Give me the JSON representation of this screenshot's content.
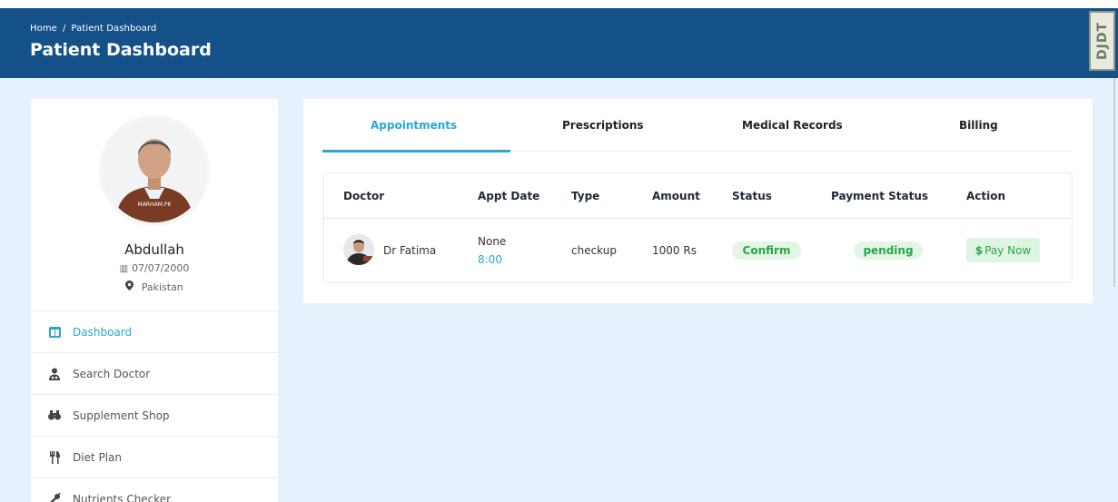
{
  "header": {
    "breadcrumb": [
      "Home",
      "Patient Dashboard"
    ],
    "breadcrumb_separator": "/",
    "title": "Patient Dashboard",
    "bg_color": "#155189"
  },
  "debug_toolbar": {
    "label": "DJDT"
  },
  "profile": {
    "avatar_watermark": "MARHAM.PK",
    "name": "Abdullah",
    "dob": "07/07/2000",
    "country": "Pakistan"
  },
  "sidebar": {
    "items": [
      {
        "label": "Dashboard",
        "icon": "dashboard-icon",
        "active": true
      },
      {
        "label": "Search Doctor",
        "icon": "doctor-icon",
        "active": false
      },
      {
        "label": "Supplement Shop",
        "icon": "binoculars-icon",
        "active": false
      },
      {
        "label": "Diet Plan",
        "icon": "utensils-icon",
        "active": false
      },
      {
        "label": "Nutrients Checker",
        "icon": "nutrients-icon",
        "active": false
      }
    ]
  },
  "tabs": [
    {
      "label": "Appointments",
      "active": true
    },
    {
      "label": "Prescriptions",
      "active": false
    },
    {
      "label": "Medical Records",
      "active": false
    },
    {
      "label": "Billing",
      "active": false
    }
  ],
  "table": {
    "columns": [
      "Doctor",
      "Appt Date",
      "Type",
      "Amount",
      "Status",
      "Payment Status",
      "Action"
    ],
    "rows": [
      {
        "doctor": "Dr Fatima",
        "date": "None",
        "time": "8:00",
        "type": "checkup",
        "amount": "1000 Rs",
        "status": "Confirm",
        "payment_status": "pending",
        "action": "Pay Now",
        "action_icon": "$"
      }
    ]
  },
  "colors": {
    "accent": "#2aa7d3",
    "success": "#27a844",
    "page_bg": "#e7f1fd"
  }
}
